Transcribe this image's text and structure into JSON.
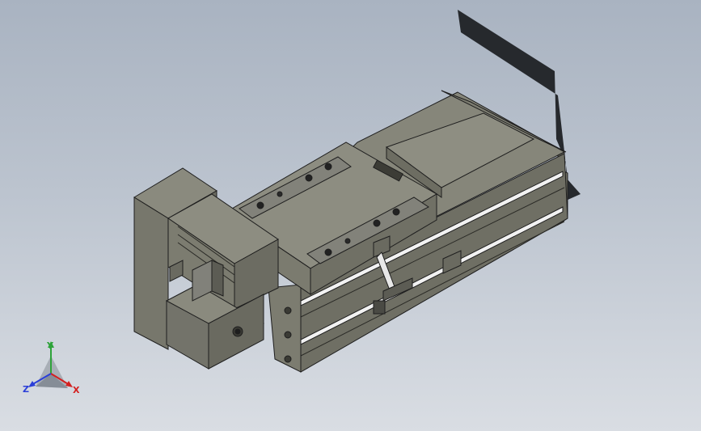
{
  "viewport": {
    "background_top": "#a9b3c1",
    "background_bottom": "#d9dde3"
  },
  "model": {
    "body_color": "#7b7b6e",
    "edge_color": "#1e1e1e",
    "shadow_color": "#26292d"
  },
  "triad": {
    "y_label": "Y",
    "z_label": "Z",
    "x_label": "X",
    "y_color": "#2ea33a",
    "z_color": "#2b3fd8",
    "x_color": "#d32020"
  }
}
